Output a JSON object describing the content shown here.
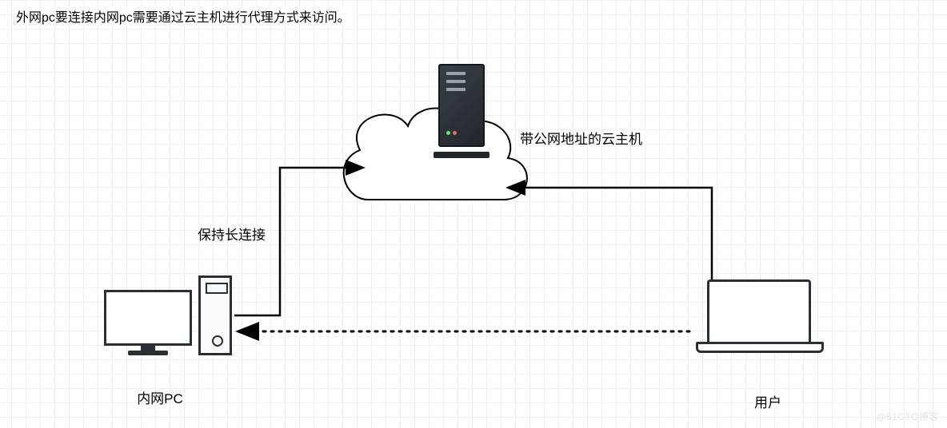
{
  "caption": "外网pc要连接内网pc需要通过云主机进行代理方式来访问。",
  "diagram": {
    "cloud_server_label": "带公网地址的云主机",
    "internal_pc_label": "内网PC",
    "user_label": "用户",
    "keep_alive_label": "保持长连接"
  },
  "watermark": "@51CTO博客",
  "icons": {
    "cloud": "cloud-icon",
    "server": "server-icon",
    "desktop": "desktop-pc-icon",
    "laptop": "laptop-icon"
  },
  "arrows": {
    "pc_to_cloud": {
      "style": "solid",
      "head": "arrow"
    },
    "user_to_cloud": {
      "style": "solid",
      "head": "arrow"
    },
    "user_to_pc": {
      "style": "dotted",
      "head": "arrow"
    }
  }
}
